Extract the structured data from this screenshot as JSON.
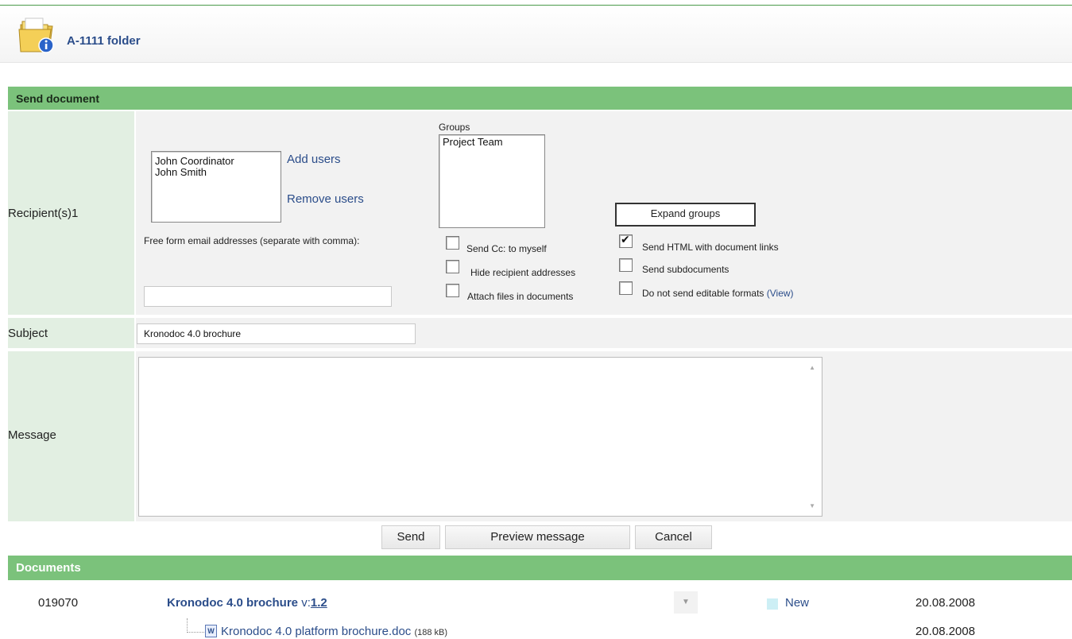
{
  "header": {
    "title": "A-1111 folder",
    "icon": "folder-info-icon"
  },
  "send_section": {
    "title": "Send document"
  },
  "recipients": {
    "label": "Recipient(s)1",
    "users": [
      "John Coordinator",
      "John Smith"
    ],
    "add_users": "Add users",
    "remove_users": "Remove users",
    "groups_label": "Groups",
    "groups": [
      "Project Team"
    ],
    "expand_groups": "Expand groups",
    "free_form_label": "Free form email addresses (separate with comma):",
    "free_form_value": ""
  },
  "options": {
    "send_cc": {
      "label": "Send Cc: to myself",
      "checked": false
    },
    "hide_addresses": {
      "label": "Hide recipient addresses",
      "checked": false
    },
    "attach_files": {
      "label": "Attach files in documents",
      "checked": false
    },
    "send_html": {
      "label": "Send HTML with document links",
      "checked": true
    },
    "send_subdocs": {
      "label": "Send subdocuments",
      "checked": false
    },
    "no_editable": {
      "label": "Do not send editable formats",
      "link": "(View)",
      "checked": false
    }
  },
  "subject": {
    "label": "Subject",
    "value": "Kronodoc 4.0 brochure"
  },
  "message": {
    "label": "Message",
    "value": ""
  },
  "buttons": {
    "send": "Send",
    "preview": "Preview message",
    "cancel": "Cancel"
  },
  "documents": {
    "title": "Documents",
    "rows": [
      {
        "id": "019070",
        "title": "Kronodoc 4.0 brochure",
        "version_prefix": "v:",
        "version": "1.2",
        "status": "New",
        "date": "20.08.2008",
        "file_name": "Kronodoc 4.0 platform brochure.doc",
        "file_size": "(188 kB)",
        "file_date": "20.08.2008"
      }
    ]
  },
  "colors": {
    "section_bar": "#7bc27b",
    "label_cell": "#e2efe2",
    "content_cell": "#f2f2f2",
    "link": "#2b4d8a",
    "status_new": "#cdeff5"
  }
}
